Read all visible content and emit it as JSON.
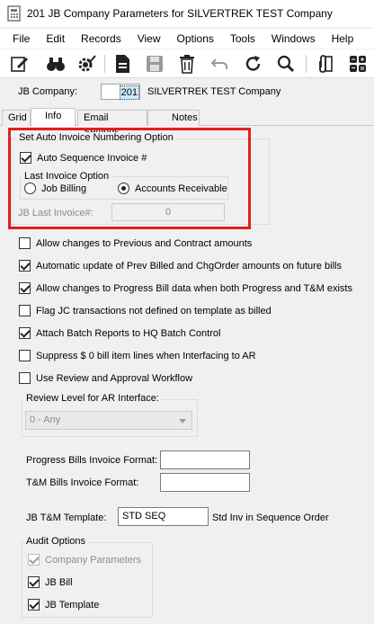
{
  "window": {
    "title": "201 JB Company Parameters for SILVERTREK TEST Company"
  },
  "menu": [
    "File",
    "Edit",
    "Records",
    "View",
    "Options",
    "Tools",
    "Windows",
    "Help"
  ],
  "company": {
    "label": "JB Company:",
    "code": "201",
    "name": "SILVERTREK TEST Company"
  },
  "tabs": [
    "Grid",
    "Info",
    "Email Settings",
    "Notes"
  ],
  "invoice_group": {
    "title": "Set Auto Invoice Numbering Option",
    "auto_sequence": "Auto Sequence Invoice #",
    "last_invoice_title": "Last Invoice Option",
    "job_billing": "Job Billing",
    "accounts_receivable": "Accounts Receivable",
    "last_invoice_label": "JB Last Invoice#:",
    "last_invoice_value": "0"
  },
  "options": [
    "Allow changes to Previous and Contract amounts",
    "Automatic update of Prev Billed and ChgOrder amounts on future bills",
    "Allow changes to Progress Bill data when both Progress and T&M exists",
    "Flag JC transactions not defined on template as billed",
    "Attach Batch Reports to HQ Batch Control",
    "Suppress $ 0 bill item lines when Interfacing to AR",
    "Use Review and Approval Workflow"
  ],
  "review": {
    "title": "Review Level for AR Interface:",
    "value": "0 - Any"
  },
  "formats": {
    "progress_label": "Progress Bills Invoice Format:",
    "tm_label": "T&M Bills Invoice Format:",
    "progress_value": "",
    "tm_value": ""
  },
  "template": {
    "label": "JB T&M Template:",
    "value": "STD SEQ",
    "description": "Std Inv in Sequence Order"
  },
  "audit": {
    "title": "Audit Options",
    "company_parameters": "Company Parameters",
    "jb_bill": "JB Bill",
    "jb_template": "JB Template"
  }
}
